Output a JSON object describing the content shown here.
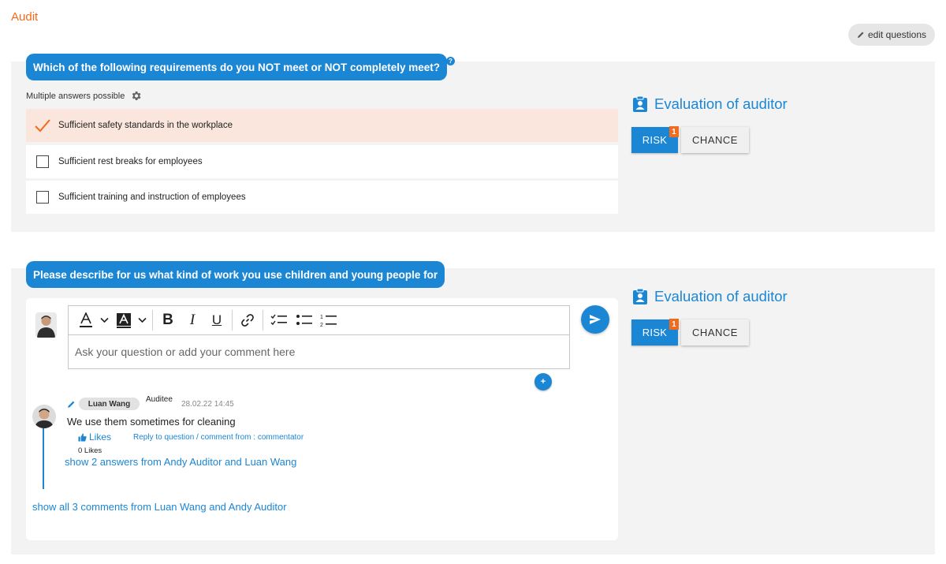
{
  "header": {
    "title": "Audit",
    "edit_label": "edit questions"
  },
  "q1": {
    "question": "Which of the following requirements do you NOT meet or NOT completely meet?",
    "help": "?",
    "hint": "Multiple answers possible",
    "options": [
      {
        "label": "Sufficient safety standards in the workplace",
        "checked": true
      },
      {
        "label": "Sufficient rest breaks for employees",
        "checked": false
      },
      {
        "label": "Sufficient training and instruction of employees",
        "checked": false
      }
    ],
    "evaluation": {
      "title": "Evaluation of auditor",
      "risk": "RISK",
      "risk_badge": "1",
      "chance": "CHANCE"
    }
  },
  "q2": {
    "question": "Please describe for us what kind of work you use children and young people for",
    "evaluation": {
      "title": "Evaluation of auditor",
      "risk": "RISK",
      "risk_badge": "1",
      "chance": "CHANCE"
    },
    "editor": {
      "placeholder": "Ask your question or add your comment here",
      "toolbar": [
        "font-color",
        "highlight-color",
        "bold",
        "italic",
        "underline",
        "link",
        "checklist",
        "bullet-list",
        "numbered-list"
      ]
    },
    "plus": "+",
    "comment": {
      "author": "Luan Wang",
      "role": "Auditee",
      "timestamp": "28.02.22 14:45",
      "text": "We use them sometimes for cleaning",
      "likes_label": "Likes",
      "reply_label": "Reply to question / comment from : commentator",
      "likes_count": "0 Likes",
      "answers_link": "show 2 answers from Andy Auditor and Luan Wang"
    },
    "all_comments_link": "show all 3 comments from Luan Wang and Andy Auditor"
  },
  "colors": {
    "accent": "#1b86d4",
    "brand_orange": "#f26b1d",
    "selected_bg": "#fae6dd",
    "panel_bg": "#f3f3f3"
  }
}
